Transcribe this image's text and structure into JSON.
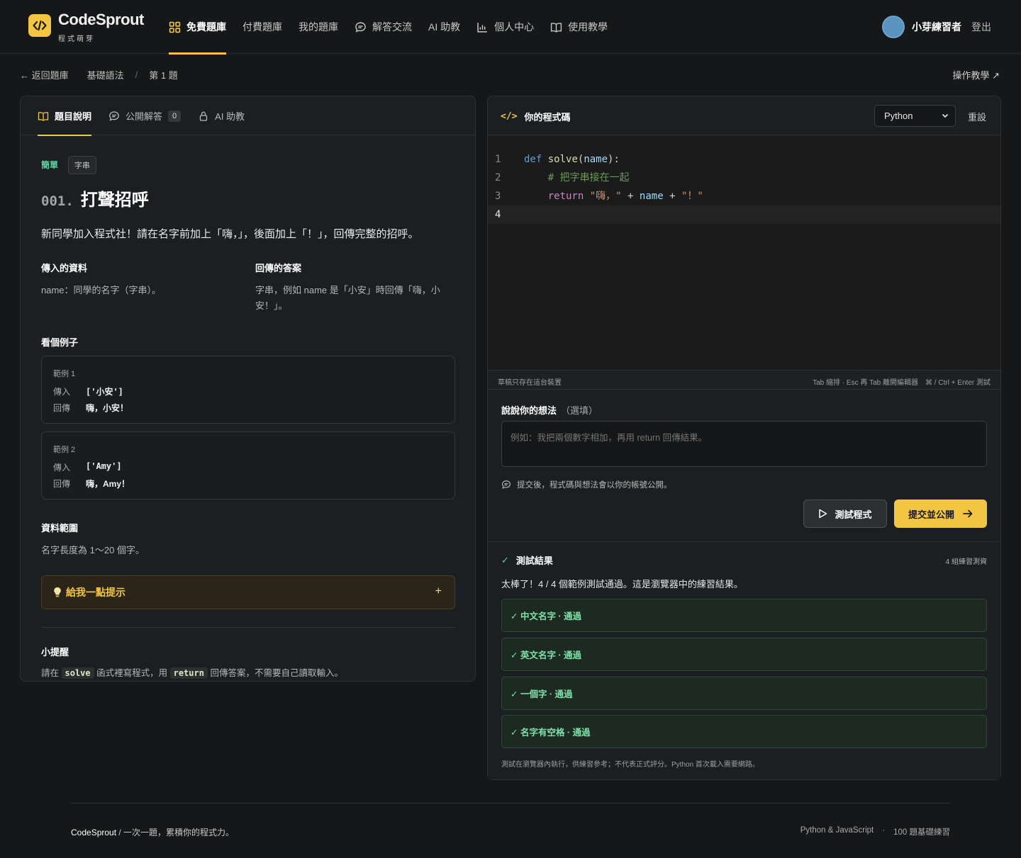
{
  "brand": {
    "name": "CodeSprout",
    "subtitle": "程式萌芽",
    "logo_icon": "code-brackets-icon",
    "accent": "#f4c542"
  },
  "nav": {
    "items": [
      {
        "label": "免費題庫",
        "icon": "grid-icon",
        "active": true
      },
      {
        "label": "付費題庫",
        "icon": "",
        "active": false
      },
      {
        "label": "我的題庫",
        "icon": "",
        "active": false
      },
      {
        "label": "解答交流",
        "icon": "chat-icon",
        "active": false
      },
      {
        "label": "AI 助教",
        "icon": "",
        "active": false
      },
      {
        "label": "個人中心",
        "icon": "bar-chart-icon",
        "active": false
      },
      {
        "label": "使用教學",
        "icon": "book-icon",
        "active": false
      }
    ],
    "user_name": "小芽練習者",
    "logout": "登出"
  },
  "breadcrumb": {
    "back": "← 返回題庫",
    "category": "基礎語法",
    "separator": "/",
    "current": "第 1 題",
    "guide": "操作教學 ↗"
  },
  "left_tabs": [
    {
      "label": "題目說明",
      "icon": "book-icon",
      "active": true
    },
    {
      "label": "公開解答",
      "icon": "chat-icon",
      "count": "0"
    },
    {
      "label": "AI 助教",
      "icon": "lock-icon"
    }
  ],
  "problem": {
    "difficulty": "簡單",
    "tag": "字串",
    "number": "001.",
    "title": "打聲招呼",
    "description": "新同學加入程式社！請在名字前加上「嗨，」，後面加上「！」，回傳完整的招呼。",
    "input_heading": "傳入的資料",
    "input_text": "name：同學的名字（字串）。",
    "output_heading": "回傳的答案",
    "output_text": "字串，例如 name 是「小安」時回傳「嗨，小安！」。",
    "examples_heading": "看個例子",
    "examples": [
      {
        "label": "範例 1",
        "in_label": "傳入",
        "in_value": "['小安']",
        "out_label": "回傳",
        "out_value": "嗨，小安！"
      },
      {
        "label": "範例 2",
        "in_label": "傳入",
        "in_value": "['Amy']",
        "out_label": "回傳",
        "out_value": "嗨，Amy！"
      }
    ],
    "range_heading": "資料範圍",
    "range_text": "名字長度為 1～20 個字。",
    "hint_label": "給我一點提示",
    "hint_plus": "+",
    "tip_heading": "小提醒",
    "tip_before": "請在",
    "tip_code1": "solve",
    "tip_mid": "函式裡寫程式，用",
    "tip_code2": "return",
    "tip_after": "回傳答案，不需要自己讀取輸入。"
  },
  "editor": {
    "title": "你的程式碼",
    "title_icon": "</>",
    "language": "Python",
    "reset": "重設",
    "line_numbers": [
      "1",
      "2",
      "3",
      "4"
    ],
    "code": {
      "l1_kw": "def",
      "l1_fn": "solve",
      "l1_p1": "(",
      "l1_param": "name",
      "l1_p2": "):",
      "l2_comment": "# 把字串接在一起",
      "l3_kw": "return",
      "l3_s1": "\"嗨，\"",
      "l3_op1": "+",
      "l3_var": "name",
      "l3_op2": "+",
      "l3_s2": "\"！\""
    },
    "status_left": "草稿只存在這台裝置",
    "status_right": "Tab 縮排 · Esc 再 Tab 離開編輯器　⌘ / Ctrl + Enter 測試"
  },
  "thoughts": {
    "heading": "說說你的想法",
    "optional": "（選填）",
    "placeholder": "例如：我把兩個數字相加，再用 return 回傳結果。",
    "public_note": "提交後，程式碼與想法會以你的帳號公開。"
  },
  "actions": {
    "test": "測試程式",
    "submit": "提交並公開"
  },
  "results": {
    "heading": "測試結果",
    "count": "4 組練習測資",
    "summary": "太棒了！4 / 4 個範例測試通過。這是瀏覽器中的練習結果。",
    "cases": [
      "✓ 中文名字 · 通過",
      "✓ 英文名字 · 通過",
      "✓ 一個字 · 通過",
      "✓ 名字有空格 · 通過"
    ],
    "footnote": "測試在瀏覽器內執行，供練習參考；不代表正式評分。Python 首次載入需要網路。"
  },
  "footer": {
    "brand": "CodeSprout",
    "slogan": " /  一次一題，累積你的程式力。",
    "langs": "Python & JavaScript",
    "dot": "·",
    "count": "100 題基礎練習"
  }
}
